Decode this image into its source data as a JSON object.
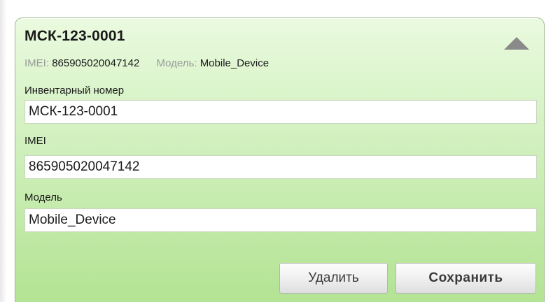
{
  "card": {
    "title": "МСК-123-0001",
    "summary": {
      "imei_key": "IMEI:",
      "imei_value": "865905020047142",
      "model_key": "Модель:",
      "model_value": "Mobile_Device"
    },
    "toggle_icon": "triangle-up-icon"
  },
  "form": {
    "inventory_label": "Инвентарный номер",
    "inventory_value": "МСК-123-0001",
    "imei_label": "IMEI",
    "imei_value": "865905020047142",
    "model_label": "Модель",
    "model_value": "Mobile_Device"
  },
  "actions": {
    "delete_label": "Удалить",
    "save_label": "Сохранить"
  },
  "colors": {
    "card_top": "#eafadf",
    "card_bottom": "#b3e393",
    "border": "#98b98a",
    "muted_text": "#9a9a9a",
    "toggle_icon": "#8a8a8a"
  }
}
